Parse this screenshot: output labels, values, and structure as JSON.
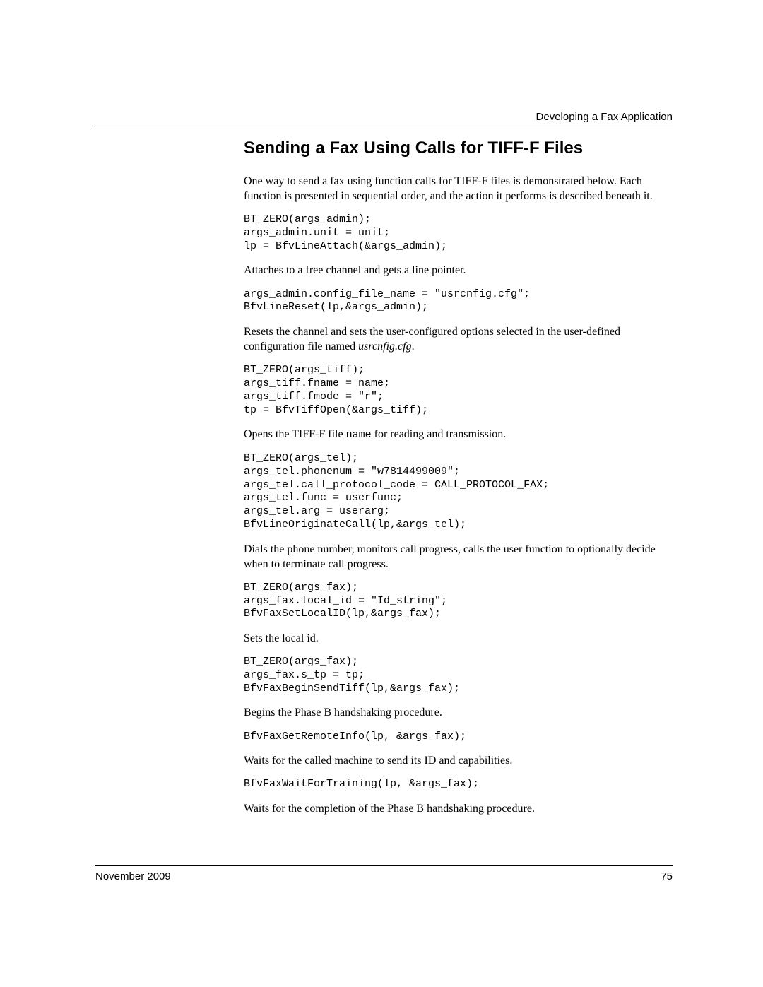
{
  "header": {
    "chapter": "Developing a Fax Application"
  },
  "section": {
    "title": "Sending a Fax Using Calls for TIFF-F Files",
    "intro": "One way to send a fax using function calls for TIFF-F files is demonstrated below. Each function is presented in sequential order, and the action it performs is described beneath it.",
    "code1": "BT_ZERO(args_admin);\nargs_admin.unit = unit;\nlp = BfvLineAttach(&args_admin);",
    "desc1": "Attaches to a free channel and gets a line pointer.",
    "code2": "args_admin.config_file_name = \"usrcnfig.cfg\";\nBfvLineReset(lp,&args_admin);",
    "desc2_pre": "Resets the channel and sets the user-configured options selected in the user-defined configuration file named ",
    "desc2_file": "usrcnfig.cfg",
    "desc2_post": ".",
    "code3": "BT_ZERO(args_tiff);\nargs_tiff.fname = name;\nargs_tiff.fmode = \"r\";\ntp = BfvTiffOpen(&args_tiff);",
    "desc3_pre": "Opens the TIFF-F file ",
    "desc3_mono": "name",
    "desc3_post": " for reading and transmission.",
    "code4": "BT_ZERO(args_tel);\nargs_tel.phonenum = \"w7814499009\";\nargs_tel.call_protocol_code = CALL_PROTOCOL_FAX;\nargs_tel.func = userfunc;\nargs_tel.arg = userarg;\nBfvLineOriginateCall(lp,&args_tel);",
    "desc4": "Dials the phone number, monitors call progress, calls the user function to optionally decide when to terminate call progress.",
    "code5": "BT_ZERO(args_fax);\nargs_fax.local_id = \"Id_string\";\nBfvFaxSetLocalID(lp,&args_fax);",
    "desc5": "Sets the local id.",
    "code6": "BT_ZERO(args_fax);\nargs_fax.s_tp = tp;\nBfvFaxBeginSendTiff(lp,&args_fax);",
    "desc6": "Begins the Phase B handshaking procedure.",
    "code7": "BfvFaxGetRemoteInfo(lp, &args_fax);",
    "desc7": "Waits for the called machine to send its ID and capabilities.",
    "code8": "BfvFaxWaitForTraining(lp, &args_fax);",
    "desc8": "Waits for the completion of the Phase B handshaking procedure."
  },
  "footer": {
    "date": "November 2009",
    "page": "75"
  }
}
